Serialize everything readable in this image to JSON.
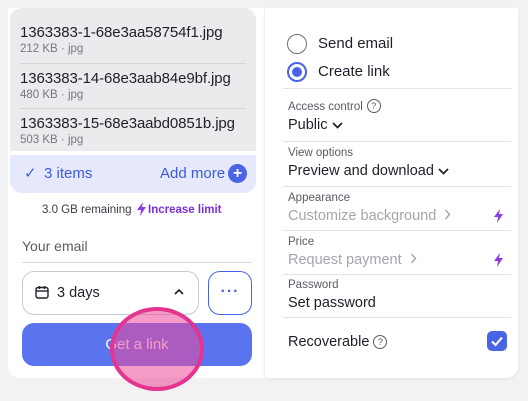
{
  "files": [
    {
      "name": "1363383-1-68e3aa58754f1.jpg",
      "meta": "212 KB · jpg"
    },
    {
      "name": "1363383-14-68e3aab84e9bf.jpg",
      "meta": "480 KB · jpg"
    },
    {
      "name": "1363383-15-68e3aabd0851b.jpg",
      "meta": "503 KB · jpg"
    }
  ],
  "items_bar": {
    "count_label": "3 items",
    "add_more_label": "Add more"
  },
  "storage": {
    "remaining": "3.0 GB remaining",
    "increase_label": "Increase limit"
  },
  "email": {
    "placeholder": "Your email"
  },
  "expiry": {
    "value": "3 days"
  },
  "get_link_label": "Get a link",
  "delivery": {
    "send_email_label": "Send email",
    "create_link_label": "Create link",
    "selected": "Create link"
  },
  "options": {
    "access_control": {
      "label": "Access control",
      "value": "Public"
    },
    "view_options": {
      "label": "View options",
      "value": "Preview and download"
    },
    "appearance": {
      "label": "Appearance",
      "value": "Customize background"
    },
    "price": {
      "label": "Price",
      "value": "Request payment"
    },
    "password": {
      "label": "Password",
      "value": "Set password"
    },
    "recoverable": {
      "label": "Recoverable",
      "checked": true
    }
  },
  "colors": {
    "accent": "#4a64e6",
    "upgrade": "#7b2fd8",
    "click_marker": "#e3348f"
  }
}
